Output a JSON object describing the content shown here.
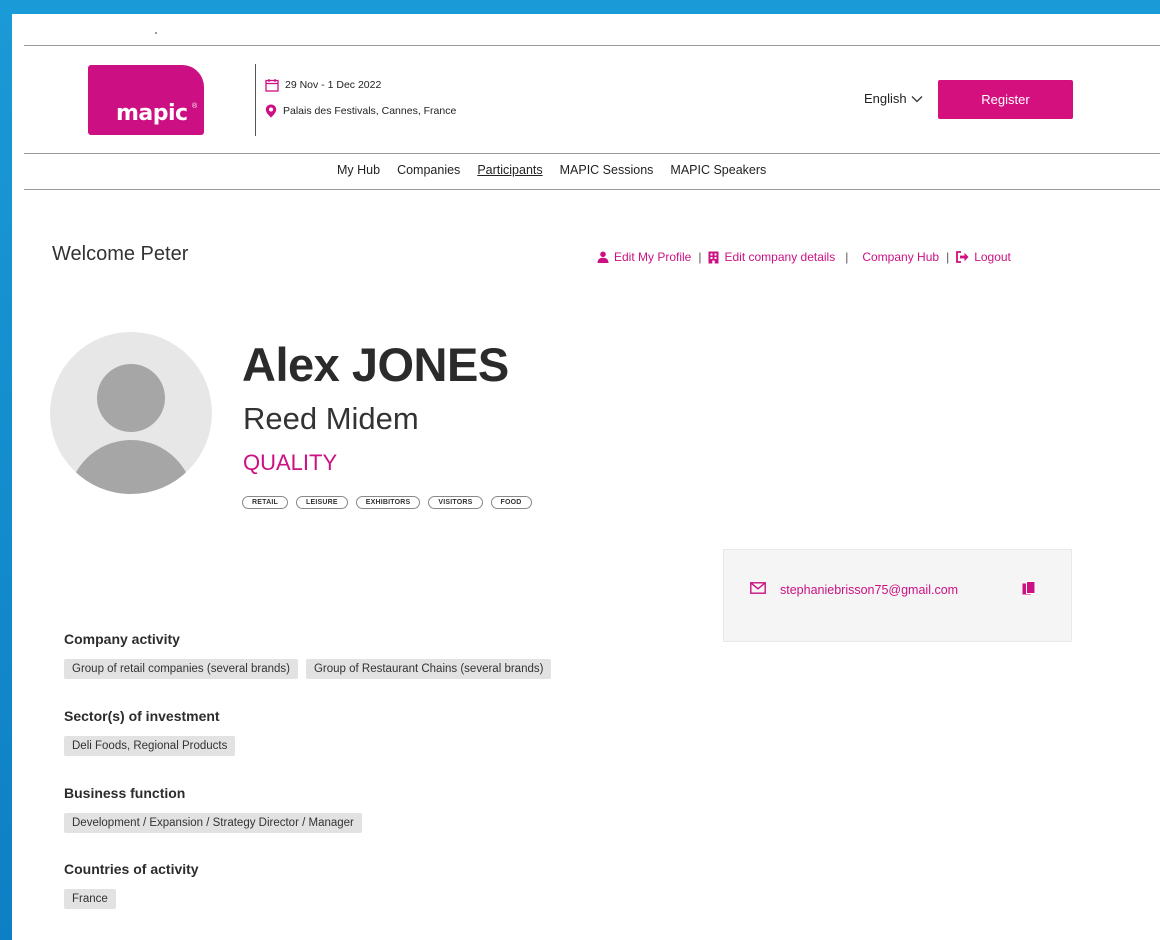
{
  "header": {
    "logo_text": "mapic",
    "logo_mark": "®",
    "event_date": "29 Nov - 1 Dec 2022",
    "event_location": "Palais des Festivals, Cannes, France",
    "language": "English",
    "register_label": "Register"
  },
  "nav": {
    "items": [
      "My Hub",
      "Companies",
      "Participants",
      "MAPIC Sessions",
      "MAPIC Speakers"
    ],
    "active": "Participants"
  },
  "welcome": "Welcome Peter",
  "user_links": {
    "edit_profile": "Edit My Profile",
    "edit_company": "Edit company details",
    "company_hub": "Company Hub",
    "logout": "Logout",
    "separator": "|"
  },
  "profile": {
    "name": "Alex JONES",
    "company": "Reed Midem",
    "quality": "QUALITY",
    "tags": [
      "RETAIL",
      "LEISURE",
      "EXHIBITORS",
      "VISITORS",
      "FOOD"
    ]
  },
  "contact": {
    "email": "stephaniebrisson75@gmail.com"
  },
  "sections": [
    {
      "title": "Company activity",
      "chips": [
        "Group of retail companies (several brands)",
        "Group of Restaurant Chains (several brands)"
      ]
    },
    {
      "title": "Sector(s) of investment",
      "chips": [
        "Deli Foods, Regional Products"
      ]
    },
    {
      "title": "Business function",
      "chips": [
        "Development / Expansion / Strategy Director / Manager"
      ]
    },
    {
      "title": "Countries of activity",
      "chips": [
        "France"
      ]
    }
  ],
  "colors": {
    "brand": "#cc0f82",
    "link": "#cc1183",
    "chip_bg": "#e2e2e2",
    "frame_blue": "#1a9ad6"
  },
  "icons": {
    "calendar": "calendar-icon",
    "location": "map-pin-icon",
    "chevron": "chevron-down-icon",
    "user": "user-icon",
    "company": "building-icon",
    "logout": "logout-icon",
    "email": "envelope-icon",
    "copy": "copy-icon"
  }
}
